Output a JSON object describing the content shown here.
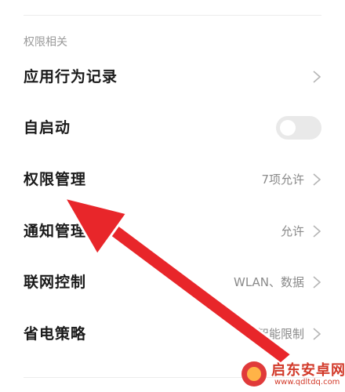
{
  "section": {
    "label": "权限相关"
  },
  "rows": [
    {
      "label": "应用行为记录",
      "value": ""
    },
    {
      "label": "自启动",
      "value": ""
    },
    {
      "label": "权限管理",
      "value": "7项允许"
    },
    {
      "label": "通知管理",
      "value": "允许"
    },
    {
      "label": "联网控制",
      "value": "WLAN、数据"
    },
    {
      "label": "省电策略",
      "value": "智能限制"
    }
  ],
  "autostart_toggle": {
    "enabled": false
  },
  "annotation": {
    "arrow_color": "#e8262a"
  },
  "watermark": {
    "title": "启东安卓网",
    "url": "www.qdltdq.com"
  },
  "colors": {
    "label": "#1a1a1a",
    "secondary": "#8a8a8a",
    "toggle_off": "#e9e9e9"
  }
}
